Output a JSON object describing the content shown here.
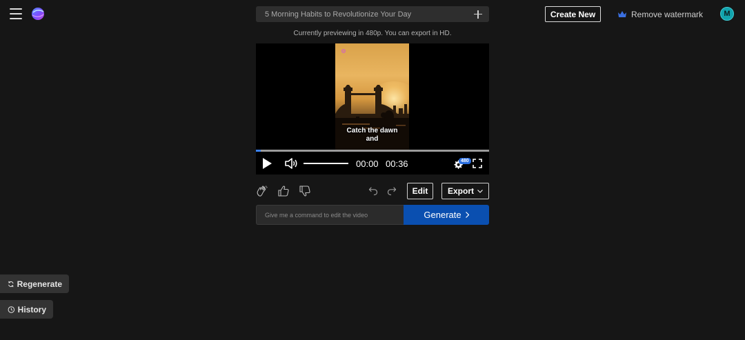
{
  "header": {
    "project_title": "5 Morning Habits to Revolutionize Your Day",
    "create_new_label": "Create New",
    "remove_watermark_label": "Remove watermark",
    "avatar_initial": "M"
  },
  "preview_note": "Currently previewing in 480p. You can export in HD.",
  "player": {
    "caption_line1": "Catch the dawn",
    "caption_line2": "and",
    "time_current": "00:00",
    "time_duration": "00:36",
    "quality_badge": "480",
    "progress_fraction": 0.02,
    "volume_fraction": 1.0
  },
  "actions": {
    "edit_label": "Edit",
    "export_label": "Export"
  },
  "command": {
    "placeholder": "Give me a command to edit the video",
    "generate_label": "Generate"
  },
  "side": {
    "regenerate_label": "Regenerate",
    "history_label": "History"
  },
  "icons": {
    "menu": "menu-icon",
    "logo": "app-logo",
    "plus": "plus-icon",
    "crown": "crown-icon",
    "play": "play-icon",
    "volume": "volume-icon",
    "settings": "gear-icon",
    "fullscreen": "fullscreen-icon",
    "clap": "clap-icon",
    "thumbs_up": "thumbs-up-icon",
    "thumbs_down": "thumbs-down-icon",
    "undo": "undo-icon",
    "redo": "redo-icon",
    "regenerate": "refresh-icon",
    "history": "clock-icon"
  },
  "colors": {
    "background": "#161616",
    "accent_blue": "#0a4fb0",
    "progress_blue": "#3b82f6",
    "avatar": "#12a3ad",
    "crown": "#3a6fe0"
  }
}
